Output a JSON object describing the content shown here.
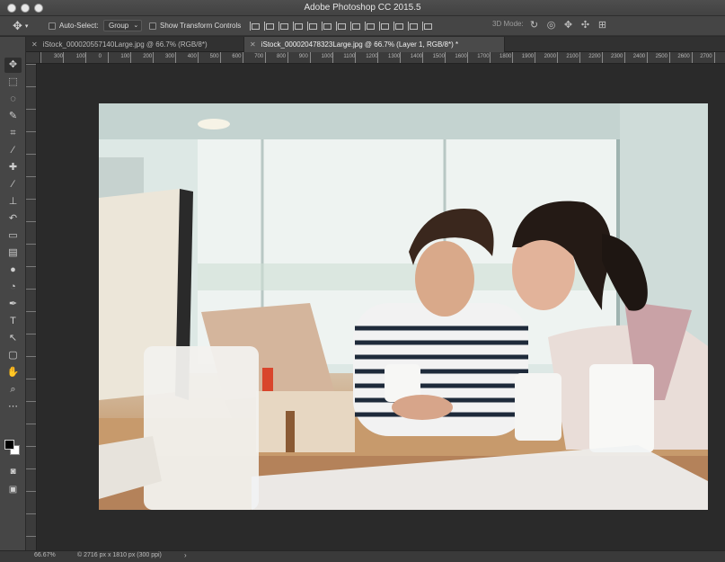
{
  "window": {
    "title": "Adobe Photoshop CC 2015.5"
  },
  "options_bar": {
    "move_tool_icon": "move-tool-icon",
    "auto_select_label": "Auto-Select:",
    "auto_select_value": "Group",
    "show_transform_label": "Show Transform Controls",
    "mode_3d_label": "3D Mode:"
  },
  "tabs": [
    {
      "label": "iStock_000020557140Large.jpg @ 66.7% (RGB/8*)"
    },
    {
      "label": "iStock_000020478323Large.jpg @ 66.7% (Layer 1, RGB/8*) *"
    }
  ],
  "ruler": {
    "marks": [
      "300",
      "100",
      "0",
      "100",
      "200",
      "300",
      "400",
      "500",
      "600",
      "700",
      "800",
      "900",
      "1000",
      "1100",
      "1200",
      "1300",
      "1400",
      "1500",
      "1600",
      "1700",
      "1800",
      "1900",
      "2000",
      "2100",
      "2200",
      "2300",
      "2400",
      "2500",
      "2600",
      "2700"
    ]
  },
  "toolbar": {
    "tools": [
      {
        "name": "move-tool-icon",
        "glyph": "✥"
      },
      {
        "name": "rectangular-marquee-icon",
        "glyph": "⬚"
      },
      {
        "name": "lasso-icon",
        "glyph": "◌"
      },
      {
        "name": "quick-selection-icon",
        "glyph": "✎"
      },
      {
        "name": "crop-icon",
        "glyph": "⌗"
      },
      {
        "name": "eyedropper-icon",
        "glyph": "⁄"
      },
      {
        "name": "spot-healing-icon",
        "glyph": "✚"
      },
      {
        "name": "brush-icon",
        "glyph": "∕"
      },
      {
        "name": "clone-stamp-icon",
        "glyph": "⊥"
      },
      {
        "name": "history-brush-icon",
        "glyph": "↶"
      },
      {
        "name": "eraser-icon",
        "glyph": "▭"
      },
      {
        "name": "gradient-icon",
        "glyph": "▤"
      },
      {
        "name": "blur-icon",
        "glyph": "●"
      },
      {
        "name": "dodge-icon",
        "glyph": "◔"
      },
      {
        "name": "pen-icon",
        "glyph": "✒"
      },
      {
        "name": "type-icon",
        "glyph": "T"
      },
      {
        "name": "path-selection-icon",
        "glyph": "↖"
      },
      {
        "name": "rectangle-shape-icon",
        "glyph": "▢"
      },
      {
        "name": "hand-icon",
        "glyph": "✋"
      },
      {
        "name": "zoom-icon",
        "glyph": "⌕"
      },
      {
        "name": "more-tools-icon",
        "glyph": "⋯"
      }
    ],
    "bottom": [
      {
        "name": "quick-mask-icon",
        "glyph": "◙"
      },
      {
        "name": "screen-mode-icon",
        "glyph": "▣"
      }
    ]
  },
  "colors": {
    "foreground": "#000000",
    "background": "#ffffff",
    "panel": "#464646",
    "canvas": "#2a2a2a"
  },
  "status": {
    "zoom": "66.67%",
    "doc_size": "© 2716 px x 1810 px (300 ppi)",
    "arrow": "›"
  }
}
